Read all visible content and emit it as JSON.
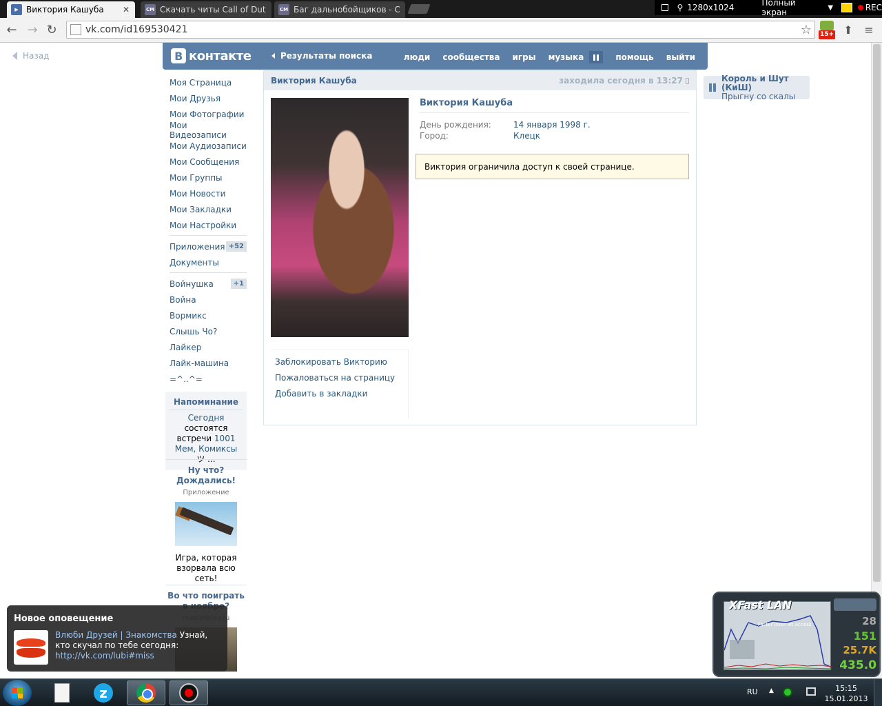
{
  "browser": {
    "tabs": [
      {
        "label": "Виктория Кашуба",
        "favicon": "vk-play-icon",
        "active": true
      },
      {
        "label": "Скачать читы Call of Duty",
        "favicon": "CM",
        "active": false
      },
      {
        "label": "Баг дальнобойщиков - С",
        "favicon": "CM",
        "active": false
      }
    ],
    "close_glyph": "✕",
    "url": "vk.com/id169530421",
    "age_badge": "15+"
  },
  "recorder": {
    "resolution": "1280x1024",
    "fullscreen_label": "Полный экран",
    "rec_label": "REC"
  },
  "vk": {
    "back_label": "Назад",
    "logo_text": "контакте",
    "logo_letter": "В",
    "search_results_label": "Результаты поиска",
    "nav": [
      "люди",
      "сообщества",
      "игры",
      "музыка",
      "помощь",
      "выйти"
    ],
    "menu_main": [
      "Моя Страница",
      "Мои Друзья",
      "Мои Фотографии",
      "Мои Видеозаписи",
      "Мои Аудиозаписи",
      "Мои Сообщения",
      "Мои Группы",
      "Мои Новости",
      "Мои Закладки",
      "Мои Настройки"
    ],
    "menu_apps": [
      {
        "label": "Приложения",
        "badge": "+52"
      },
      {
        "label": "Документы",
        "badge": ""
      }
    ],
    "menu_games": [
      {
        "label": "Войнушка",
        "badge": "+1"
      },
      {
        "label": "Война",
        "badge": ""
      },
      {
        "label": "Вормикс",
        "badge": ""
      },
      {
        "label": "Слышь Чо?",
        "badge": ""
      },
      {
        "label": "Лайкер",
        "badge": ""
      },
      {
        "label": "Лайк-машина",
        "badge": ""
      },
      {
        "label": "=^..^=",
        "badge": ""
      }
    ],
    "reminder": {
      "title": "Напоминание",
      "today": "Сегодня",
      "text1": "состоятся встречи",
      "events": "1001 Мем, Комиксы",
      "text2": "ツ ..."
    },
    "ads": [
      {
        "title": "Ну что? Дождались!",
        "sub": "Приложение",
        "desc": "Игра, которая взорвала всю сеть!"
      },
      {
        "title": "Во что поиграть в ноябре?",
        "sub": "masterplay.ru",
        "desc": ""
      }
    ],
    "profile": {
      "header_name": "Виктория Кашуба",
      "last_seen": "заходила сегодня в 13:27",
      "name": "Виктория Кашуба",
      "birthday_label": "День рождения:",
      "birthday_value": "14 января 1998 г.",
      "city_label": "Город:",
      "city_value": "Клецк",
      "restricted_msg": "Виктория ограничила доступ к своей странице.",
      "actions": [
        "Заблокировать Викторию",
        "Пожаловаться на страницу",
        "Добавить в закладки"
      ]
    },
    "mini_player": {
      "artist": "Король и Шут (КиШ)",
      "song": "Прыгну со скалы"
    }
  },
  "notification": {
    "title": "Новое оповещение",
    "app": "Влюби Друзей | Знакомства",
    "text": "Узнай, кто скучал по тебе сегодня:",
    "link": "http://vk.com/lubi#miss"
  },
  "gadget": {
    "logo": "XFast LAN",
    "logo_sub": "Faster Internet Access",
    "stats": [
      "28",
      "151",
      "25.7K",
      "435.0"
    ]
  },
  "taskbar": {
    "lang": "RU",
    "time": "15:15",
    "date": "15.01.2013"
  }
}
